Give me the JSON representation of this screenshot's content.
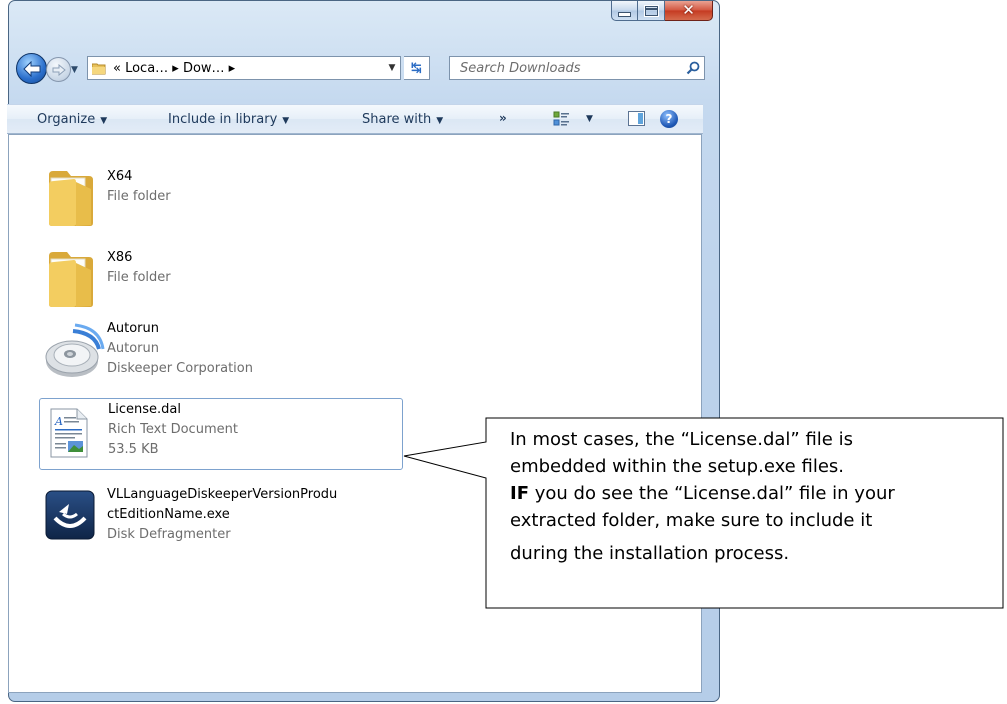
{
  "window": {
    "caption_buttons": {
      "minimize": "minimize",
      "maximize": "maximize",
      "close": "close"
    }
  },
  "address_bar": {
    "breadcrumb": "« Loca… ▸ Dow… ▸",
    "search_placeholder": "Search Downloads"
  },
  "command_bar": {
    "organize": "Organize",
    "include_in_library": "Include in library",
    "share_with": "Share with",
    "more": "»"
  },
  "files": [
    {
      "name": "X64",
      "line2": "File folder",
      "icon": "folder-icon"
    },
    {
      "name": "X86",
      "line2": "File folder",
      "icon": "folder-icon"
    },
    {
      "name": "Autorun",
      "line2": "Autorun",
      "line3": "Diskeeper Corporation",
      "icon": "disc-icon"
    },
    {
      "name": "License.dal",
      "line2": "Rich Text Document",
      "line3": "53.5 KB",
      "icon": "rich-text-document-icon",
      "selected": true
    },
    {
      "name_line1": "VLLanguageDiskeeperVersionProdu",
      "name_line2": "ctEditionName.exe",
      "line3": "Disk Defragmenter",
      "icon": "diskeeper-app-icon"
    }
  ],
  "callout": {
    "line1": "In most cases, the “License.dal” file is",
    "line2": "embedded within the setup.exe files.",
    "line3_bold": "IF",
    "line3_rest": " you do see the “License.dal” file in your",
    "line4": "extracted folder, make sure to include it",
    "line5": "during the installation process."
  },
  "colors": {
    "frame": "#b5cde8",
    "command_text": "#1e395b",
    "secondary_text": "#6d6d6d",
    "selection_border": "#7da2ce",
    "close_button": "#c53a21"
  }
}
